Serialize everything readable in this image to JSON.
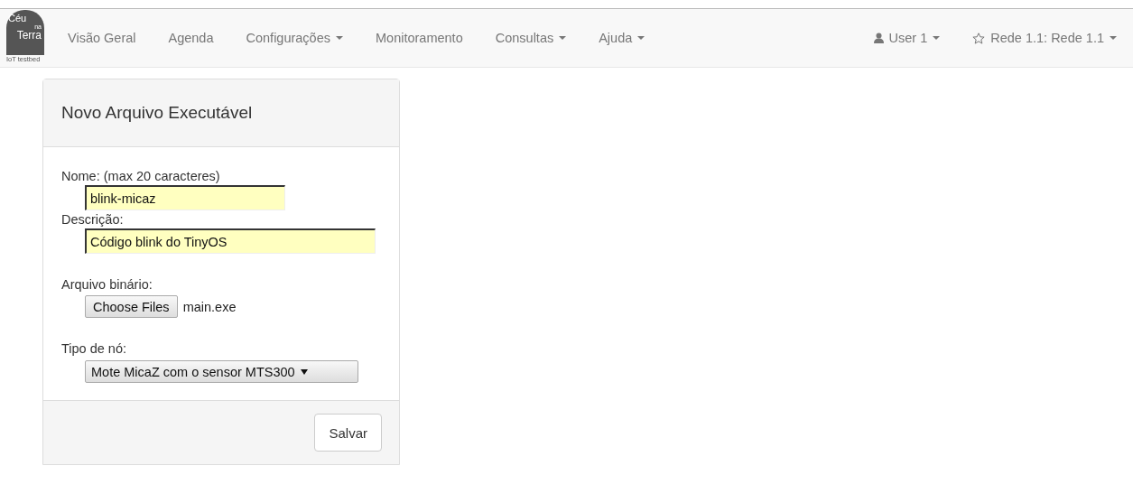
{
  "logo": {
    "line_1": "Céu",
    "line_2": "na",
    "line_3": "Terra",
    "tagline": "IoT testbed"
  },
  "nav": [
    {
      "label": "Visão Geral",
      "dropdown": false
    },
    {
      "label": "Agenda",
      "dropdown": false
    },
    {
      "label": "Configurações",
      "dropdown": true
    },
    {
      "label": "Monitoramento",
      "dropdown": false
    },
    {
      "label": "Consultas",
      "dropdown": true
    },
    {
      "label": "Ajuda",
      "dropdown": true
    }
  ],
  "nav_right": [
    {
      "label": "User 1",
      "kind": "user",
      "dropdown": true
    },
    {
      "label": "Rede 1.1: Rede 1.1",
      "kind": "star",
      "dropdown": true
    }
  ],
  "panel": {
    "title": "Novo Arquivo Executável",
    "fields": [
      {
        "kind": "text",
        "label": "Nome: (max 20 caracteres)",
        "value": "blink-micaz"
      },
      {
        "kind": "text",
        "label": "Descrição:",
        "value": "Código blink do TinyOS"
      },
      {
        "kind": "file",
        "label": "Arquivo binário:",
        "button": "Choose Files",
        "value": "main.exe"
      },
      {
        "kind": "select",
        "label": "Tipo de nó:",
        "value": "Mote MicaZ com o sensor MTS300"
      }
    ],
    "save_button": "Salvar"
  }
}
